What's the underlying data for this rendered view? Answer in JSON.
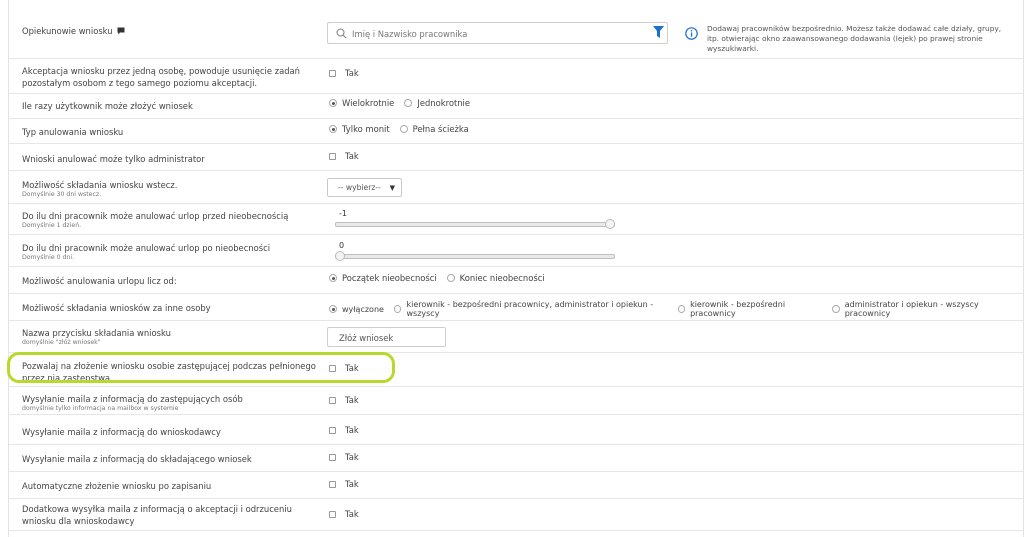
{
  "rows": {
    "guardians": {
      "label": "Opiekunowie wniosku",
      "search_placeholder": "Imię i Nazwisko pracownika",
      "info_text": "Dodawaj pracowników bezpośrednio. Możesz także dodawać całe działy, grupy, itp. otwierając okno zaawansowanego dodawania (lejek) po prawej stronie wyszukiwarki."
    },
    "single_accept": {
      "label": "Akceptacja wniosku przez jedną osobę, powoduje usunięcie zadań pozostałym osobom z tego samego poziomu akceptacji.",
      "checkbox_label": "Tak"
    },
    "times": {
      "label": "Ile razy użytkownik może złożyć wniosek",
      "options": [
        "Wielokrotnie",
        "Jednokrotnie"
      ]
    },
    "cancel_type": {
      "label": "Typ anulowania wniosku",
      "options": [
        "Tylko monit",
        "Pełna ścieżka"
      ]
    },
    "admin_only": {
      "label": "Wnioski anulować może tylko administrator",
      "checkbox_label": "Tak"
    },
    "backdate": {
      "label": "Możliwość składania wniosku wstecz.",
      "hint": "Domyślnie 30 dni wstecz.",
      "select_value": "-- wybierz--"
    },
    "before_absence": {
      "label": "Do ilu dni pracownik może anulować urlop przed nieobecnością",
      "hint": "Domyślnie 1 dzień.",
      "value": "-1",
      "fraction": 1.0
    },
    "after_absence": {
      "label": "Do ilu dni pracownik może anulować urlop po nieobecności",
      "hint": "Domyślnie 0 dni.",
      "value": "0",
      "fraction": 0.0
    },
    "cancel_count_from": {
      "label": "Możliwość anulowania urlopu licz od:",
      "options": [
        "Początek nieobecności",
        "Koniec nieobecności"
      ]
    },
    "for_others": {
      "label": "Możliwość składania wniosków za inne osoby",
      "options": [
        "wyłączone",
        "kierownik - bezpośredni pracownicy, administrator i opiekun - wszyscy",
        "kierownik - bezpośredni pracownicy",
        "administrator i opiekun - wszyscy pracownicy"
      ]
    },
    "button_name": {
      "label": "Nazwa przycisku składania wniosku",
      "hint": "domyślnie \"złóż wniosek\"",
      "value": "Złóż wniosek"
    },
    "substitute": {
      "label": "Pozwalaj na złożenie wniosku osobie zastępującej podczas pełnionego przez nią zastępstwa",
      "checkbox_label": "Tak"
    },
    "mail_substitutes": {
      "label": "Wysyłanie maila z informacją do zastępujących osób",
      "hint": "domyślnie tylko informacja na mailbox w systemie",
      "checkbox_label": "Tak"
    },
    "mail_applicant": {
      "label": "Wysyłanie maila z informacją do wnioskodawcy",
      "checkbox_label": "Tak"
    },
    "mail_submitter": {
      "label": "Wysyłanie maila z informacją do składającego wniosek",
      "checkbox_label": "Tak"
    },
    "auto_submit": {
      "label": "Automatyczne złożenie wniosku po zapisaniu",
      "checkbox_label": "Tak"
    },
    "extra_mail": {
      "label": "Dodatkowa wysyłka maila z informacją o akceptacji i odrzuceniu wniosku dla wnioskodawcy",
      "checkbox_label": "Tak"
    }
  },
  "colors": {
    "highlight": "#b7d92b",
    "filter_icon": "#1a6fd1",
    "info_icon": "#1a6fd1"
  }
}
